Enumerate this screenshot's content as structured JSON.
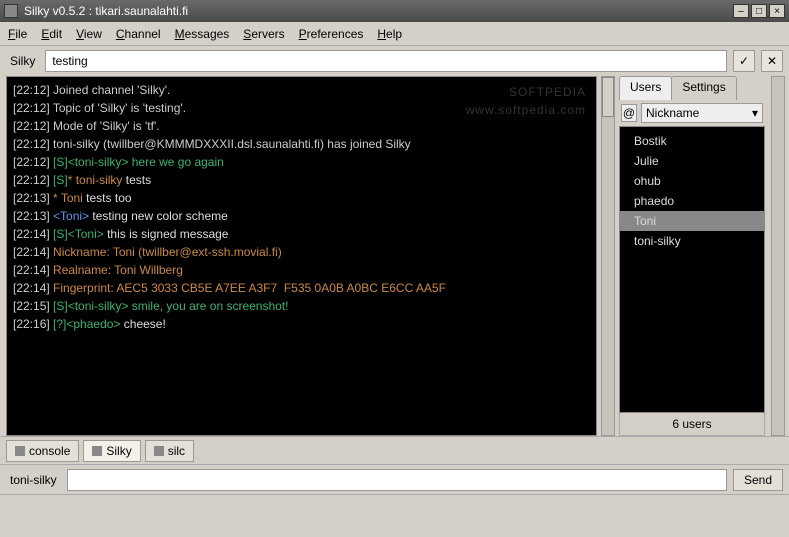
{
  "window": {
    "title": "Silky v0.5.2 : tikari.saunalahti.fi"
  },
  "menu": {
    "file": "File",
    "edit": "Edit",
    "view": "View",
    "channel": "Channel",
    "messages": "Messages",
    "servers": "Servers",
    "preferences": "Preferences",
    "help": "Help"
  },
  "topic": {
    "label": "Silky",
    "value": "testing",
    "accept_icon": "✓",
    "cancel_icon": "✕"
  },
  "watermark": {
    "line1": "SOFTPEDIA",
    "line2": "www.softpedia.com"
  },
  "chat": [
    {
      "ts": "[22:12]",
      "parts": [
        {
          "cls": "sys",
          "t": " Joined channel 'Silky'."
        }
      ]
    },
    {
      "ts": "[22:12]",
      "parts": [
        {
          "cls": "sys",
          "t": " Topic of 'Silky' is 'testing'."
        }
      ]
    },
    {
      "ts": "[22:12]",
      "parts": [
        {
          "cls": "sys",
          "t": " Mode of 'Silky' is 'tf'."
        }
      ]
    },
    {
      "ts": "[22:12]",
      "parts": [
        {
          "cls": "sys",
          "t": " toni-silky (twillber@KMMMDXXXII.dsl.saunalahti.fi) has joined Silky"
        }
      ]
    },
    {
      "ts": "[22:12]",
      "parts": [
        {
          "cls": "nick-g",
          "t": " [S]<toni-silky>"
        },
        {
          "cls": "msg-g",
          "t": " here we go again"
        }
      ]
    },
    {
      "ts": "[22:12]",
      "parts": [
        {
          "cls": "nick-g",
          "t": " [S]"
        },
        {
          "cls": "star",
          "t": "* toni-silky"
        },
        {
          "cls": "msg-w",
          "t": " tests"
        }
      ]
    },
    {
      "ts": "[22:13]",
      "parts": [
        {
          "cls": "star",
          "t": " * Toni"
        },
        {
          "cls": "msg-w",
          "t": " tests too"
        }
      ]
    },
    {
      "ts": "[22:13]",
      "parts": [
        {
          "cls": "nick-b",
          "t": " <Toni>"
        },
        {
          "cls": "msg-w",
          "t": " testing new color scheme"
        }
      ]
    },
    {
      "ts": "[22:14]",
      "parts": [
        {
          "cls": "nick-g",
          "t": " [S]<Toni>"
        },
        {
          "cls": "msg-w",
          "t": " this is signed message"
        }
      ]
    },
    {
      "ts": "[22:14]",
      "parts": [
        {
          "cls": "msg-o",
          "t": " Nickname: Toni (twillber@ext-ssh.movial.fi)"
        }
      ]
    },
    {
      "ts": "[22:14]",
      "parts": [
        {
          "cls": "msg-o",
          "t": " Realname: Toni Willberg"
        }
      ]
    },
    {
      "ts": "[22:14]",
      "parts": [
        {
          "cls": "msg-o",
          "t": " Fingerprint: AEC5 3033 CB5E A7EE A3F7  F535 0A0B A0BC E6CC AA5F"
        }
      ]
    },
    {
      "ts": "[22:15]",
      "parts": [
        {
          "cls": "nick-g",
          "t": " [S]<toni-silky>"
        },
        {
          "cls": "msg-g",
          "t": " smile, you are on screenshot!"
        }
      ]
    },
    {
      "ts": "[22:16]",
      "parts": [
        {
          "cls": "nick-g",
          "t": " [?]<phaedo>"
        },
        {
          "cls": "msg-w",
          "t": " cheese!"
        }
      ]
    }
  ],
  "side": {
    "tabs": {
      "users": "Users",
      "settings": "Settings"
    },
    "sort_at": "@",
    "sort_label": "Nickname",
    "nicks": [
      "Bostik",
      "Julie",
      "ohub",
      "phaedo",
      "Toni",
      "toni-silky"
    ],
    "selected": "Toni",
    "count_label": "6 users"
  },
  "channel_tabs": {
    "console": "console",
    "silky": "Silky",
    "silc": "silc"
  },
  "input": {
    "nick": "toni-silky",
    "value": "",
    "send": "Send"
  }
}
